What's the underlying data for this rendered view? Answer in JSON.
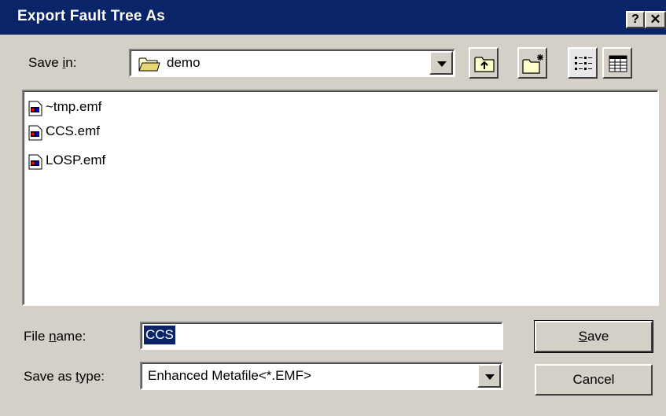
{
  "window": {
    "title": "Export Fault Tree As",
    "help_glyph": "?",
    "close_glyph": "✕"
  },
  "save_in": {
    "label_pre": "Save ",
    "label_hot": "i",
    "label_post": "n:",
    "folder_name": "demo",
    "folder_icon": "folder-icon"
  },
  "toolbar": {
    "icons": [
      "up-one-level-icon",
      "create-new-folder-icon",
      "list-view-icon",
      "details-view-icon"
    ]
  },
  "files": [
    {
      "name": "~tmp.emf",
      "icon": "emf-file-icon"
    },
    {
      "name": "CCS.emf",
      "icon": "emf-file-icon"
    },
    {
      "name": "LOSP.emf",
      "icon": "emf-file-icon"
    }
  ],
  "file_name": {
    "label_pre": "File ",
    "label_hot": "n",
    "label_post": "ame:",
    "value": "CCS"
  },
  "save_as_type": {
    "label_pre": "Save as ",
    "label_hot": "t",
    "label_post": "ype:",
    "selected": "Enhanced Metafile<*.EMF>"
  },
  "buttons": {
    "save_hot": "S",
    "save_rest": "ave",
    "cancel": "Cancel"
  },
  "colors": {
    "titlebar": "#0a246a",
    "dialog_face": "#d4d0c8",
    "selection": "#0a246a"
  }
}
